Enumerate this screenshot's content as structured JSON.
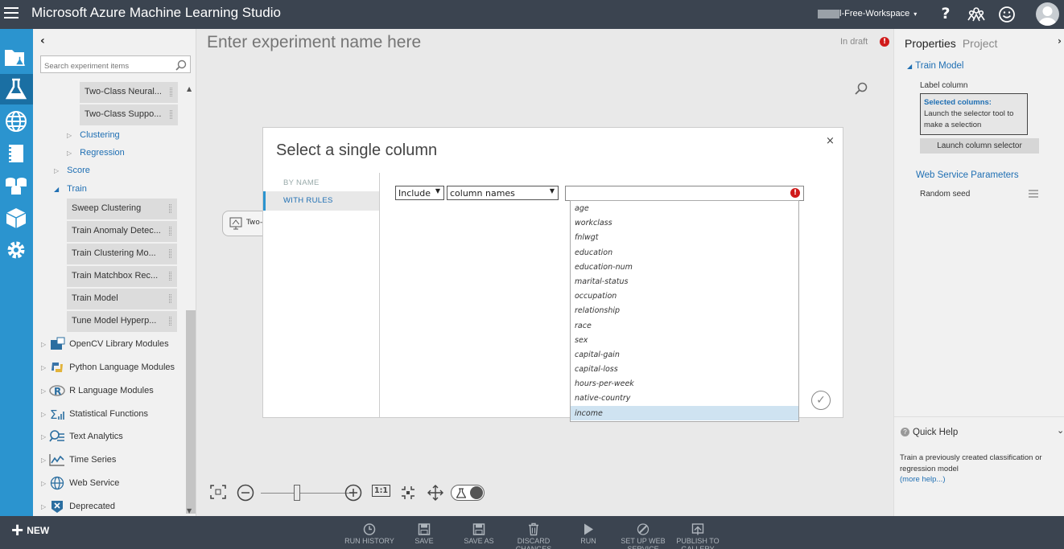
{
  "header": {
    "app_title": "Microsoft Azure Machine Learning Studio",
    "workspace": "l-Free-Workspace",
    "help": "?"
  },
  "palette": {
    "search_placeholder": "Search experiment items",
    "items": [
      {
        "label": "Two-Class Neural..."
      },
      {
        "label": "Two-Class Suppo..."
      }
    ],
    "nodes": [
      {
        "label": "Clustering"
      },
      {
        "label": "Regression"
      },
      {
        "label": "Score"
      },
      {
        "label": "Train"
      }
    ],
    "train_items": [
      {
        "label": "Sweep Clustering"
      },
      {
        "label": "Train Anomaly Detec..."
      },
      {
        "label": "Train Clustering Mo..."
      },
      {
        "label": "Train Matchbox Rec..."
      },
      {
        "label": "Train Model"
      },
      {
        "label": "Tune Model Hyperp..."
      }
    ],
    "categories": [
      {
        "label": "OpenCV Library Modules"
      },
      {
        "label": "Python Language Modules"
      },
      {
        "label": "R Language Modules"
      },
      {
        "label": "Statistical Functions"
      },
      {
        "label": "Text Analytics"
      },
      {
        "label": "Time Series"
      },
      {
        "label": "Web Service"
      },
      {
        "label": "Deprecated"
      }
    ]
  },
  "canvas": {
    "experiment_placeholder": "Enter experiment name here",
    "status": "In draft",
    "node_label": "Two-",
    "zoom_fit": "1:1"
  },
  "properties": {
    "tab_properties": "Properties",
    "tab_project": "Project",
    "section": "Train Model",
    "label_column": "Label column",
    "selected_title": "Selected columns:",
    "selected_desc": "Launch the selector tool to make a selection",
    "launch_button": "Launch column selector",
    "web_service_params": "Web Service Parameters",
    "random_seed": "Random seed",
    "quick_help_title": "Quick Help",
    "quick_help_text": "Train a previously created classification or regression model",
    "more_help": "(more help...)"
  },
  "modal": {
    "title": "Select a single column",
    "close": "×",
    "nav": [
      {
        "label": "BY NAME"
      },
      {
        "label": "WITH RULES"
      }
    ],
    "include_value": "Include",
    "type_value": "column names",
    "columns": [
      "age",
      "workclass",
      "fnlwgt",
      "education",
      "education-num",
      "marital-status",
      "occupation",
      "relationship",
      "race",
      "sex",
      "capital-gain",
      "capital-loss",
      "hours-per-week",
      "native-country",
      "income"
    ],
    "selected_column": "income"
  },
  "bottombar": {
    "new": "NEW",
    "commands": [
      {
        "label": "RUN HISTORY",
        "icon": "history-icon"
      },
      {
        "label": "SAVE",
        "icon": "save-icon"
      },
      {
        "label": "SAVE AS",
        "icon": "save-as-icon"
      },
      {
        "label": "DISCARD CHANGES",
        "icon": "trash-icon"
      },
      {
        "label": "RUN",
        "icon": "play-icon"
      },
      {
        "label": "SET UP WEB SERVICE",
        "icon": "web-service-icon"
      },
      {
        "label": "PUBLISH TO GALLERY",
        "icon": "publish-icon"
      }
    ]
  },
  "colors": {
    "topbar": "#3b4450",
    "rail": "#2b94cf",
    "accent": "#1f6fb3",
    "error": "#d01a1a"
  }
}
